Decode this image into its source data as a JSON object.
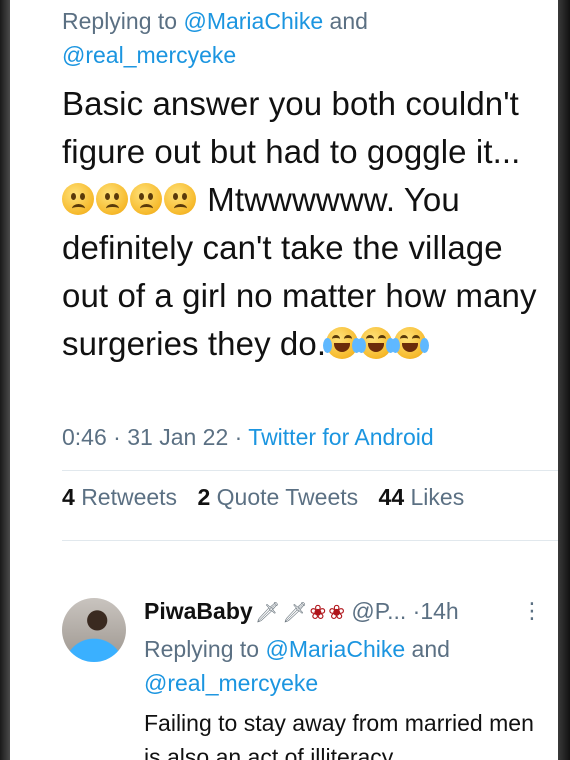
{
  "tweet": {
    "replying_prefix": "Replying to",
    "reply_handle_1": "@MariaChike",
    "reply_and": "and",
    "reply_handle_2": "@real_mercyeke",
    "text_part1": "Basic answer you both couldn't figure out but had to goggle it...",
    "text_part2": " Mtwwwwww. You definitely can't take the village out of a girl no matter how many surgeries they do.",
    "emoji_group_1": [
      "confused-face-icon",
      "confused-face-icon",
      "confused-face-icon",
      "confused-face-icon"
    ],
    "emoji_group_2": [
      "tears-of-joy-icon",
      "tears-of-joy-icon",
      "tears-of-joy-icon"
    ],
    "time": "0:46",
    "date": "31 Jan 22",
    "source": "Twitter for Android"
  },
  "stats": {
    "retweets_count": "4",
    "retweets_label": "Retweets",
    "quotes_count": "2",
    "quotes_label": "Quote Tweets",
    "likes_count": "44",
    "likes_label": "Likes"
  },
  "reply": {
    "name": "PiwaBaby",
    "name_decorations": [
      "dagger-icon",
      "dagger-icon",
      "rose-icon",
      "rose-icon"
    ],
    "handle": "@P...",
    "time": "14h",
    "replying_prefix": "Replying to",
    "reply_handle_1": "@MariaChike",
    "reply_and": "and",
    "reply_handle_2": "@real_mercyeke",
    "text": "Failing to stay away from married men is also an act of illiteracy"
  },
  "colors": {
    "link": "#1b95e0",
    "secondary_text": "#5b7083",
    "primary_text": "#111111"
  }
}
